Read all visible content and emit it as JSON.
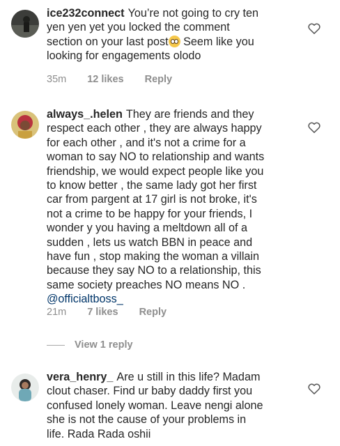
{
  "comments": [
    {
      "username": "ice232connect",
      "lines": [
        "You’re not going to cry ten",
        "yen yen yet you locked the comment",
        "section on your last post",
        "looking for engagements olodo"
      ],
      "line3_suffix": "Seem like you",
      "emoji": "flushed-face-emoji",
      "time": "35m",
      "likes": "12 likes",
      "reply": "Reply"
    },
    {
      "username": "always_.helen",
      "lines": [
        "They are friends and they",
        "respect each other , they are always happy",
        "for each other , and it's not a crime for a",
        "woman to say NO to relationship and wants",
        "friendship, we would expect people like you",
        "to know better , the same lady got her first",
        "car from pargent at 17 girl is not broke, it's",
        "not a crime to be happy for your friends, I",
        "wonder y you having a meltdown all of a",
        "sudden , lets us watch BBN in peace and",
        "have fun , stop making the woman a villain",
        "because they say NO to a relationship, this",
        "same society preaches NO means NO ."
      ],
      "mention": "@officialtboss_",
      "time": "21m",
      "likes": "7 likes",
      "reply": "Reply"
    },
    {
      "username": "vera_henry_",
      "lines": [
        "Are u still in this life? Madam",
        "clout chaser. Find ur baby daddy first you",
        "confused lonely woman. Leave nengi alone",
        "she is not the cause of your problems in",
        "life. Rada Rada oshii"
      ]
    }
  ],
  "view_replies": "View 1 reply",
  "colors": {
    "text": "#262626",
    "meta": "#8e8e8e",
    "mention": "#003569"
  }
}
